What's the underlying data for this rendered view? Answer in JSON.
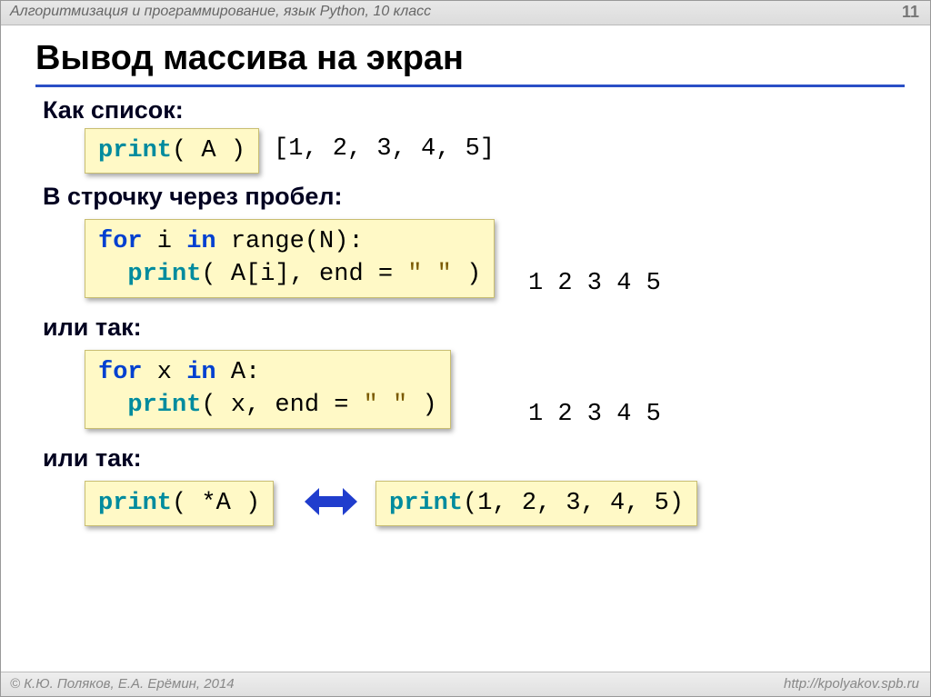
{
  "header": {
    "title": "Алгоритмизация и программирование, язык Python, 10 класс",
    "page": "11"
  },
  "footer": {
    "authors": "© К.Ю. Поляков, Е.А. Ерёмин, 2014",
    "url": "http://kpolyakov.spb.ru"
  },
  "title": "Вывод массива на экран",
  "sections": {
    "s1": "Как список:",
    "s2": "В строчку через пробел:",
    "s3": "или так:",
    "s4": "или так:"
  },
  "code": {
    "c1": {
      "fn": "print",
      "args": "( A )"
    },
    "c2_l1_a": "for",
    "c2_l1_b": " i ",
    "c2_l1_c": "in",
    "c2_l1_d": " range(N):",
    "c2_l2_a": "  ",
    "c2_l2_fn": "print",
    "c2_l2_b": "( A[i], end = ",
    "c2_l2_str": "\" \"",
    "c2_l2_c": " )",
    "c3_l1_a": "for",
    "c3_l1_b": " x ",
    "c3_l1_c": "in",
    "c3_l1_d": " A:",
    "c3_l2_a": "  ",
    "c3_l2_fn": "print",
    "c3_l2_b": "( x, end = ",
    "c3_l2_str": "\" \"",
    "c3_l2_c": " )",
    "c4": {
      "fn": "print",
      "args": "( *A )"
    },
    "c5": {
      "fn": "print",
      "args": "(1, 2, 3, 4, 5)"
    }
  },
  "outputs": {
    "o1": "[1, 2, 3, 4, 5]",
    "o2": "1 2 3 4 5",
    "o3": "1 2 3 4 5"
  }
}
